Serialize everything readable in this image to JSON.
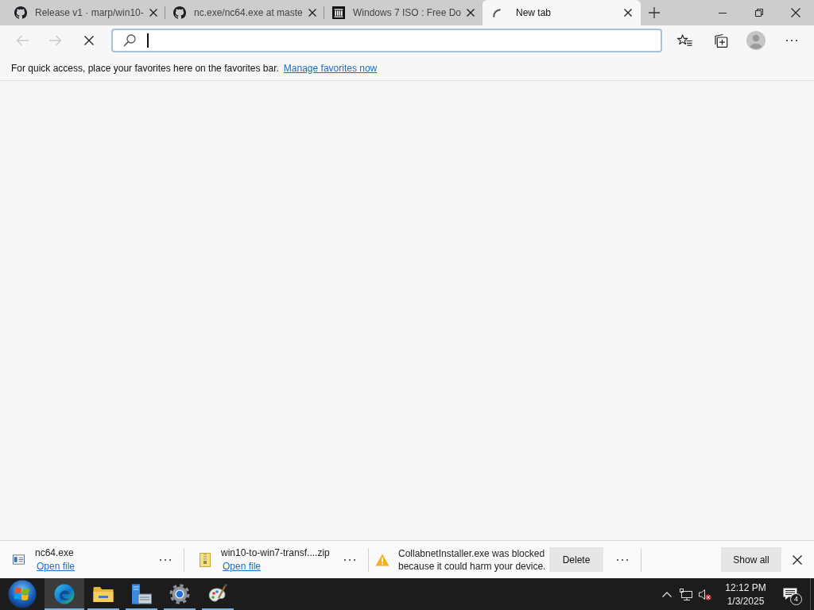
{
  "tabs": [
    {
      "kind": "github",
      "title": "Release v1 · marp/win10-",
      "selected": false
    },
    {
      "kind": "github",
      "title": "nc.exe/nc64.exe at maste",
      "selected": false
    },
    {
      "kind": "archive",
      "title": "Windows 7 ISO : Free Do",
      "selected": false
    },
    {
      "kind": "loading",
      "title": "New tab",
      "selected": true
    }
  ],
  "toolbar": {
    "back_disabled": true,
    "forward_disabled": true,
    "loading": true
  },
  "address_bar": {
    "focused": true
  },
  "favorites_bar": {
    "message": "For quick access, place your favorites here on the favorites bar.",
    "link": "Manage favorites now"
  },
  "downloads": [
    {
      "kind": "app",
      "filename": "nc64.exe",
      "action": "Open file"
    },
    {
      "kind": "archive",
      "filename": "win10-to-win7-transf....zip",
      "action": "Open file"
    },
    {
      "kind": "blocked",
      "message": "CollabnetInstaller.exe was blocked because it could harm your device.",
      "button": "Delete"
    }
  ],
  "show_all": "Show all",
  "taskbar": {
    "apps": [
      {
        "kind": "start",
        "active": false,
        "running": false
      },
      {
        "kind": "edge",
        "active": true,
        "running": true
      },
      {
        "kind": "explorer",
        "active": false,
        "running": true
      },
      {
        "kind": "server",
        "active": false,
        "running": true
      },
      {
        "kind": "settings",
        "active": false,
        "running": true
      },
      {
        "kind": "paint",
        "active": false,
        "running": true
      }
    ]
  },
  "tray": {
    "sound_error": true,
    "time": "12:12 PM",
    "date": "1/3/2025",
    "notifications": "4"
  }
}
